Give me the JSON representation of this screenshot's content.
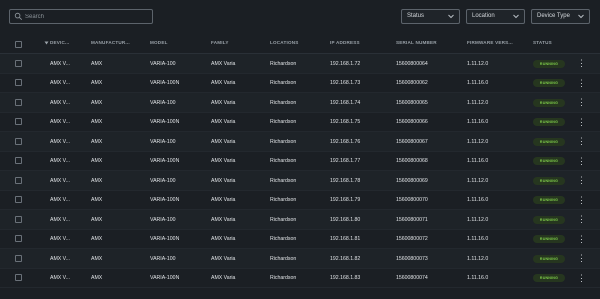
{
  "toolbar": {
    "search_placeholder": "Search",
    "filters": [
      {
        "label": "Status"
      },
      {
        "label": "Location"
      },
      {
        "label": "Device Type"
      }
    ]
  },
  "table": {
    "columns": [
      "DEVIC...",
      "MANUFACTUR...",
      "MODEL",
      "FAMILY",
      "LOCATIONS",
      "IP ADDRESS",
      "SERIAL NUMBER",
      "FIRMWARE VERS...",
      "STATUS"
    ],
    "rows": [
      {
        "device": "AMX V...",
        "manufacturer": "AMX",
        "model": "VARIA-100",
        "family": "AMX Varia",
        "location": "Richardson",
        "ip": "192.168.1.72",
        "serial": "15600800064",
        "firmware": "1.11.12.0",
        "status": "RUNNING"
      },
      {
        "device": "AMX V...",
        "manufacturer": "AMX",
        "model": "VARIA-100N",
        "family": "AMX Varia",
        "location": "Richardson",
        "ip": "192.168.1.73",
        "serial": "15600800062",
        "firmware": "1.11.16.0",
        "status": "RUNNING"
      },
      {
        "device": "AMX V...",
        "manufacturer": "AMX",
        "model": "VARIA-100",
        "family": "AMX Varia",
        "location": "Richardson",
        "ip": "192.168.1.74",
        "serial": "15600800065",
        "firmware": "1.11.12.0",
        "status": "RUNNING"
      },
      {
        "device": "AMX V...",
        "manufacturer": "AMX",
        "model": "VARIA-100N",
        "family": "AMX Varia",
        "location": "Richardson",
        "ip": "192.168.1.75",
        "serial": "15600800066",
        "firmware": "1.11.16.0",
        "status": "RUNNING"
      },
      {
        "device": "AMX V...",
        "manufacturer": "AMX",
        "model": "VARIA-100",
        "family": "AMX Varia",
        "location": "Richardson",
        "ip": "192.168.1.76",
        "serial": "15600800067",
        "firmware": "1.11.12.0",
        "status": "RUNNING"
      },
      {
        "device": "AMX V...",
        "manufacturer": "AMX",
        "model": "VARIA-100N",
        "family": "AMX Varia",
        "location": "Richardson",
        "ip": "192.168.1.77",
        "serial": "15600800068",
        "firmware": "1.11.16.0",
        "status": "RUNNING"
      },
      {
        "device": "AMX V...",
        "manufacturer": "AMX",
        "model": "VARIA-100",
        "family": "AMX Varia",
        "location": "Richardson",
        "ip": "192.168.1.78",
        "serial": "15600800069",
        "firmware": "1.11.12.0",
        "status": "RUNNING"
      },
      {
        "device": "AMX V...",
        "manufacturer": "AMX",
        "model": "VARIA-100N",
        "family": "AMX Varia",
        "location": "Richardson",
        "ip": "192.168.1.79",
        "serial": "15600800070",
        "firmware": "1.11.16.0",
        "status": "RUNNING"
      },
      {
        "device": "AMX V...",
        "manufacturer": "AMX",
        "model": "VARIA-100",
        "family": "AMX Varia",
        "location": "Richardson",
        "ip": "192.168.1.80",
        "serial": "15600800071",
        "firmware": "1.11.12.0",
        "status": "RUNNING"
      },
      {
        "device": "AMX V...",
        "manufacturer": "AMX",
        "model": "VARIA-100N",
        "family": "AMX Varia",
        "location": "Richardson",
        "ip": "192.168.1.81",
        "serial": "15600800072",
        "firmware": "1.11.16.0",
        "status": "RUNNING"
      },
      {
        "device": "AMX V...",
        "manufacturer": "AMX",
        "model": "VARIA-100",
        "family": "AMX Varia",
        "location": "Richardson",
        "ip": "192.168.1.82",
        "serial": "15600800073",
        "firmware": "1.11.12.0",
        "status": "RUNNING"
      },
      {
        "device": "AMX V...",
        "manufacturer": "AMX",
        "model": "VARIA-100N",
        "family": "AMX Varia",
        "location": "Richardson",
        "ip": "192.168.1.83",
        "serial": "15600800074",
        "firmware": "1.11.16.0",
        "status": "RUNNING"
      }
    ],
    "sort_icon": "sort-descending-icon",
    "row_menu_icon": "kebab-menu-icon"
  },
  "colors": {
    "background": "#1b1f24",
    "status_running_bg": "#26361f",
    "status_running_text": "#7fcf4a"
  }
}
